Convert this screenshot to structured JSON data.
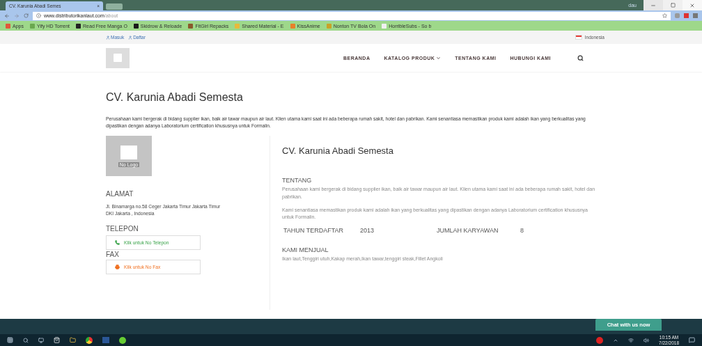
{
  "browser": {
    "tab_title": "CV. Karunia Abadi Semes",
    "tab_close": "×",
    "profile": "dau",
    "address": {
      "domain": "www.distributorikanlaut.com",
      "path": "/about"
    },
    "bookmarks": [
      {
        "label": "Apps",
        "color": "#e0583a"
      },
      {
        "label": "Yify HD Torrent",
        "color": "#6aa84f"
      },
      {
        "label": "Read Free Manga O",
        "color": "#222222"
      },
      {
        "label": "Skidrow & Reloade",
        "color": "#1a1a1a"
      },
      {
        "label": "FitGirl Repacks",
        "color": "#8a5a2b"
      },
      {
        "label": "Shared Material - E",
        "color": "#e8b93a"
      },
      {
        "label": "KissAnime",
        "color": "#e8802a"
      },
      {
        "label": "Nonton TV Bola On",
        "color": "#c9a227"
      },
      {
        "label": "HorribleSubs - So b",
        "color": "#f0f0f0"
      }
    ]
  },
  "topbar": {
    "links": [
      "Masuk",
      "Daftar"
    ],
    "language": "Indonesia"
  },
  "nav": {
    "items": [
      {
        "label": "BERANDA",
        "dropdown": false
      },
      {
        "label": "KATALOG PRODUK",
        "dropdown": true
      },
      {
        "label": "TENTANG KAMI",
        "dropdown": false
      },
      {
        "label": "HUBUNGI KAMI",
        "dropdown": false
      }
    ]
  },
  "page": {
    "title": "CV. Karunia Abadi Semesta",
    "intro": "Perusahaan kami bergerak di bidang supplier ikan, baik air tawar maupun air laut. Klien utama kami saat ini ada beberapa rumah sakit, hotel dan pabrikan. Kami senantiasa memastikan produk kami adalah ikan yang berkualitas yang dipastikan dengan adanya Laboratorium certification khususnya untuk Formalin."
  },
  "sidebar": {
    "logo_text": "No Logo",
    "address_heading": "ALAMAT",
    "address_lines": [
      "Jl. Binamarga no.58 Ceger Jakarta Timur Jakarta Timur",
      "DKI Jakarta , Indonesia"
    ],
    "contacts": [
      {
        "heading": "TELEPON",
        "button": "Klik untuk No Telepon",
        "kind": "phone"
      },
      {
        "heading": "FAX",
        "button": "Klik untuk No Fax",
        "kind": "fax"
      }
    ]
  },
  "profile": {
    "title": "CV. Karunia Abadi Semesta",
    "about_heading": "TENTANG",
    "about": [
      "Perusahaan kami bergerak di bidang supplier ikan, baik air tawar maupun air laut. Klien utama kami saat ini ada beberapa rumah sakit, hotel dan pabrikan.",
      "Kami senantiasa memastikan produk kami adalah ikan yang berkualitas yang dipastikan dengan adanya Laboratorium certification khususnya untuk Formalin."
    ],
    "stats": [
      {
        "label": "TAHUN TERDAFTAR",
        "value": "2013"
      },
      {
        "label": "JUMLAH KARYAWAN",
        "value": "8"
      }
    ],
    "sell_heading": "KAMI MENJUAL",
    "sell": "Ikan laut,Tenggiri utuh,Kakap merah,Ikan tawar,tenggiri steak,Fillet Angkoli"
  },
  "chat": "Chat with us now",
  "taskbar": {
    "time": "10:15 AM",
    "date": "7/22/2018"
  }
}
